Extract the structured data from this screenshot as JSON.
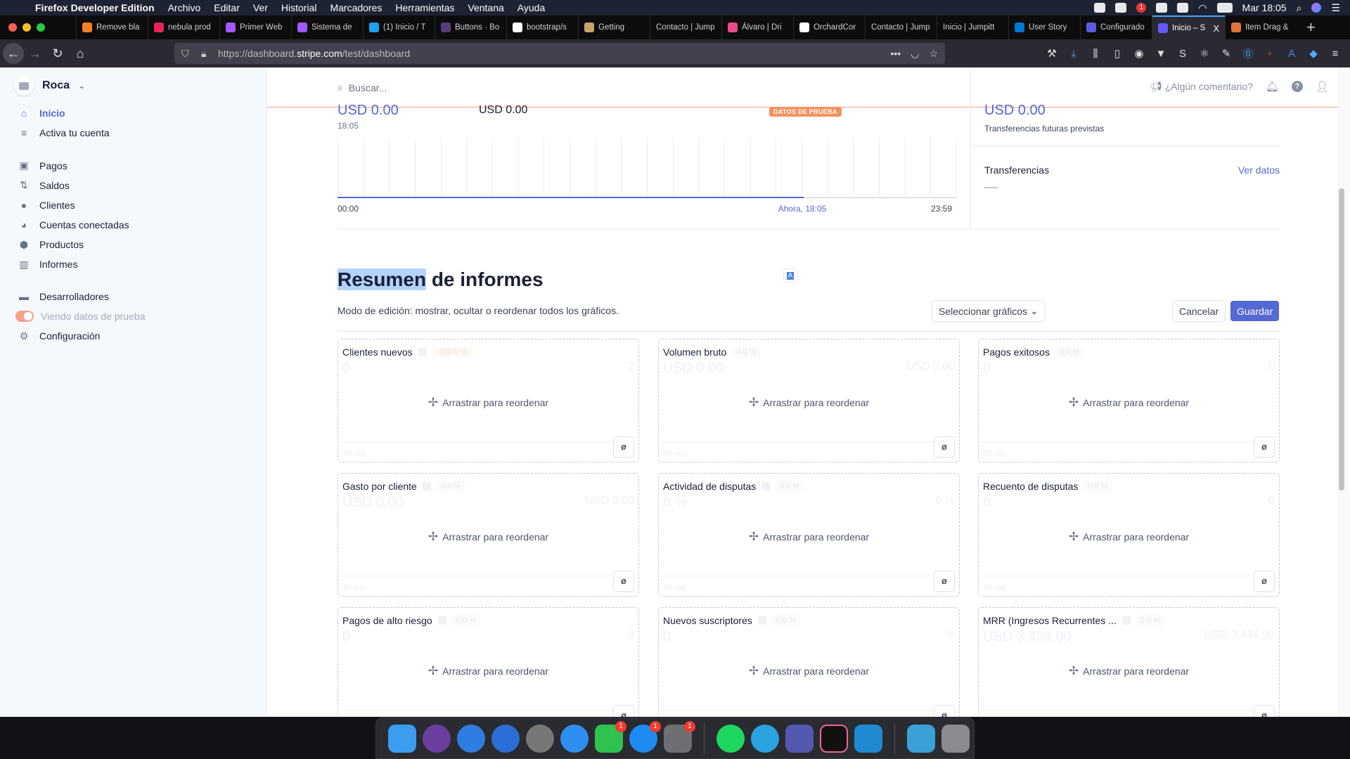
{
  "menubar": {
    "app": "Firefox Developer Edition",
    "items": [
      "Archivo",
      "Editar",
      "Ver",
      "Historial",
      "Marcadores",
      "Herramientas",
      "Ventana",
      "Ayuda"
    ],
    "clock": "Mar 18:05",
    "notification_badge": "1"
  },
  "tabs": [
    {
      "label": "Remove bla",
      "color": "#f48024"
    },
    {
      "label": "nebula prod",
      "color": "#e8245c"
    },
    {
      "label": "Primer Web",
      "color": "#a259ff"
    },
    {
      "label": "Sistema de",
      "color": "#a259ff"
    },
    {
      "label": "(1) Inicio / T",
      "color": "#1da1f2"
    },
    {
      "label": "Buttons · Bo",
      "color": "#563d7c"
    },
    {
      "label": "bootstrap/s",
      "color": "#ffffff"
    },
    {
      "label": "Getting",
      "color": "#c8a26b"
    },
    {
      "label": "Contacto | Jump",
      "color": ""
    },
    {
      "label": "Álvaro | Dri",
      "color": "#ea4c89"
    },
    {
      "label": "OrchardCor",
      "color": "#ffffff"
    },
    {
      "label": "Contacto | Jump",
      "color": ""
    },
    {
      "label": "Inicio | Jumpitt",
      "color": ""
    },
    {
      "label": "User Story",
      "color": "#0078d4"
    },
    {
      "label": "Configurado",
      "color": "#5c5ce0"
    },
    {
      "label": "Inicio – S",
      "color": "#635bff",
      "active": true
    },
    {
      "label": "Item Drag &",
      "color": "#e0743a"
    }
  ],
  "tab_close": "X",
  "new_tab": "+",
  "url": {
    "prefix": "https://dashboard.",
    "domain": "stripe.com",
    "path": "/test/dashboard"
  },
  "sidebar": {
    "account": "Roca",
    "items": [
      {
        "label": "Inicio",
        "icon": "home-icon",
        "glyph": "⌂",
        "active": true
      },
      {
        "label": "Activa tu cuenta",
        "icon": "edit-list-icon",
        "glyph": "≡"
      },
      {
        "label": "Pagos",
        "icon": "wallet-icon",
        "glyph": "▣"
      },
      {
        "label": "Saldos",
        "icon": "arrows-updown-icon",
        "glyph": "⇅"
      },
      {
        "label": "Clientes",
        "icon": "user-circle-icon",
        "glyph": "●"
      },
      {
        "label": "Cuentas conectadas",
        "icon": "connected-icon",
        "glyph": "◕"
      },
      {
        "label": "Productos",
        "icon": "box-icon",
        "glyph": "⬢"
      },
      {
        "label": "Informes",
        "icon": "report-icon",
        "glyph": "▥"
      },
      {
        "label": "Desarrolladores",
        "icon": "terminal-icon",
        "glyph": "▬"
      },
      {
        "label": "Viendo datos de prueba",
        "icon": "toggle",
        "toggle_on": true
      },
      {
        "label": "Configuración",
        "icon": "gear-icon",
        "glyph": "⚙"
      }
    ]
  },
  "topbar": {
    "search_placeholder": "Buscar...",
    "feedback": "¿Algún comentario?"
  },
  "overview": {
    "today_value": "USD 0.00",
    "yesterday_value": "USD 0.00",
    "time": "18:05",
    "test_badge": "DATOS DE PRUEBA",
    "axis_start": "00:00",
    "axis_now": "Ahora, 18:05",
    "axis_end": "23:59",
    "now_fraction": 0.753,
    "future_value": "USD 0.00",
    "future_label": "Transferencias futuras previstas",
    "transfers_title": "Transferencias",
    "view_data": "Ver datos"
  },
  "reports": {
    "title_selected": "Resumen",
    "title_rest": " de informes",
    "description": "Modo de edición: mostrar, ocultar o reordenar todos los gráficos.",
    "select_charts": "Seleccionar gráficos",
    "cancel": "Cancelar",
    "save": "Guardar",
    "drag_label": "Arrastrar para reordenar",
    "cards": [
      {
        "title": "Clientes nuevos",
        "info": true,
        "change": "-100.0 %",
        "negative": true,
        "value": "0",
        "compare": "2",
        "date": "30 sep."
      },
      {
        "title": "Volumen bruto",
        "info": false,
        "change": "0.0 %",
        "value": "USD 0.00",
        "compare": "USD 0.00",
        "date": "30 sep."
      },
      {
        "title": "Pagos exitosos",
        "info": false,
        "change": "0.0 %",
        "value": "0",
        "compare": "0",
        "date": "30 sep."
      },
      {
        "title": "Gasto por cliente",
        "info": true,
        "change": "0.0 %",
        "value": "USD 0.00",
        "compare": "USD 0.00",
        "date": "30 sep."
      },
      {
        "title": "Actividad de disputas",
        "info": true,
        "change": "0.0 %",
        "value": "0 %",
        "compare": "0 %",
        "date": "30 sep."
      },
      {
        "title": "Recuento de disputas",
        "info": false,
        "change": "0.0 %",
        "value": "0",
        "compare": "0",
        "date": "30 sep."
      },
      {
        "title": "Pagos de alto riesgo",
        "info": true,
        "change": "0.0 %",
        "value": "0",
        "compare": "0",
        "date": ""
      },
      {
        "title": "Nuevos suscriptores",
        "info": true,
        "change": "0.0 %",
        "value": "0",
        "compare": "0",
        "date": ""
      },
      {
        "title": "MRR (Ingresos Recurrentes ...",
        "info": true,
        "change": "0.0 %",
        "value": "USD 3,434.00",
        "compare": "USD 3,434.00",
        "date": ""
      }
    ]
  },
  "dock": [
    {
      "name": "finder",
      "color": "#3b9cf0"
    },
    {
      "name": "siri",
      "color": "#6b3fa0",
      "round": true
    },
    {
      "name": "spark",
      "color": "#2f7de0",
      "round": true
    },
    {
      "name": "firefox",
      "color": "#2b6fd6",
      "round": true
    },
    {
      "name": "launchpad",
      "color": "#777",
      "round": true
    },
    {
      "name": "safari",
      "color": "#2f8ff0",
      "round": true
    },
    {
      "name": "facetime",
      "color": "#2ec24e",
      "badge": "1"
    },
    {
      "name": "app-store",
      "color": "#1d8bf1",
      "round": true,
      "badge": "1"
    },
    {
      "name": "system-preferences",
      "color": "#6f6f73",
      "badge": "1"
    },
    {
      "sep": true
    },
    {
      "name": "spotify",
      "color": "#1ed760",
      "round": true
    },
    {
      "name": "telegram",
      "color": "#2aa3e0",
      "round": true
    },
    {
      "name": "teams",
      "color": "#5558af"
    },
    {
      "name": "terminal",
      "color": "#111",
      "border": "#f0629a"
    },
    {
      "name": "vscode",
      "color": "#1f8ad2"
    },
    {
      "sep": true
    },
    {
      "name": "downloads-folder",
      "color": "#3aa0d8"
    },
    {
      "name": "trash",
      "color": "#8a8a8f"
    }
  ]
}
